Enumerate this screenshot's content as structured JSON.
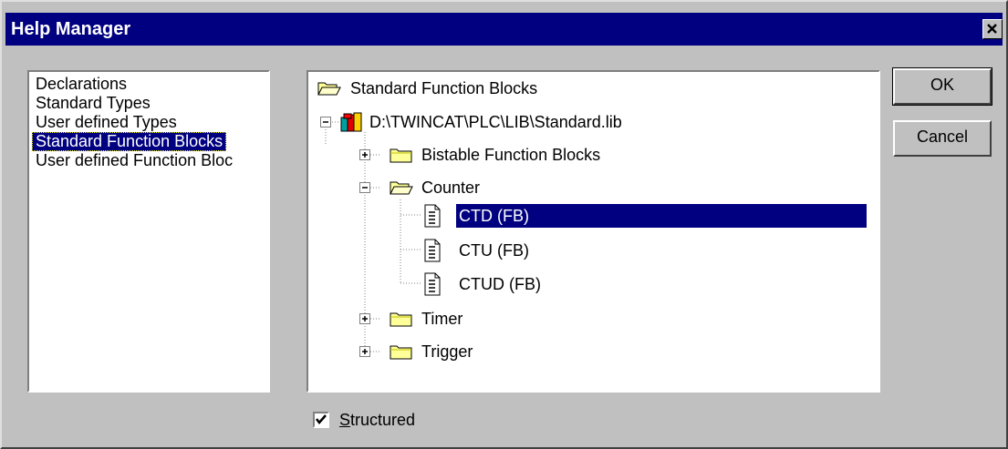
{
  "window": {
    "title": "Help Manager",
    "close_label": "✕"
  },
  "categories": [
    {
      "label": "Declarations",
      "selected": false
    },
    {
      "label": "Standard Types",
      "selected": false
    },
    {
      "label": "User defined Types",
      "selected": false
    },
    {
      "label": "Standard Function Blocks",
      "selected": true
    },
    {
      "label": "User defined Function Bloc",
      "selected": false
    }
  ],
  "tree": {
    "root": {
      "label": "Standard Function Blocks",
      "icon": "open-folder-icon"
    },
    "library": {
      "label": "D:\\TWINCAT\\PLC\\LIB\\Standard.lib",
      "icon": "books-icon",
      "expanded": true
    },
    "groups": [
      {
        "label": "Bistable Function Blocks",
        "icon": "folder-icon",
        "expanded": false
      },
      {
        "label": "Counter",
        "icon": "open-folder-icon",
        "expanded": true,
        "children": [
          {
            "label": "CTD (FB)",
            "icon": "document-icon",
            "selected": true
          },
          {
            "label": "CTU (FB)",
            "icon": "document-icon",
            "selected": false
          },
          {
            "label": "CTUD (FB)",
            "icon": "document-icon",
            "selected": false
          }
        ]
      },
      {
        "label": "Timer",
        "icon": "folder-icon",
        "expanded": false
      },
      {
        "label": "Trigger",
        "icon": "folder-icon",
        "expanded": false
      }
    ]
  },
  "buttons": {
    "ok": "OK",
    "cancel": "Cancel"
  },
  "structured_checkbox": {
    "label_mnemonic": "S",
    "label_rest": "tructured",
    "checked": true
  },
  "colors": {
    "title_bar": "#000080",
    "face": "#c0c0c0",
    "selection": "#000080",
    "folder_yellow": "#ffff99"
  }
}
